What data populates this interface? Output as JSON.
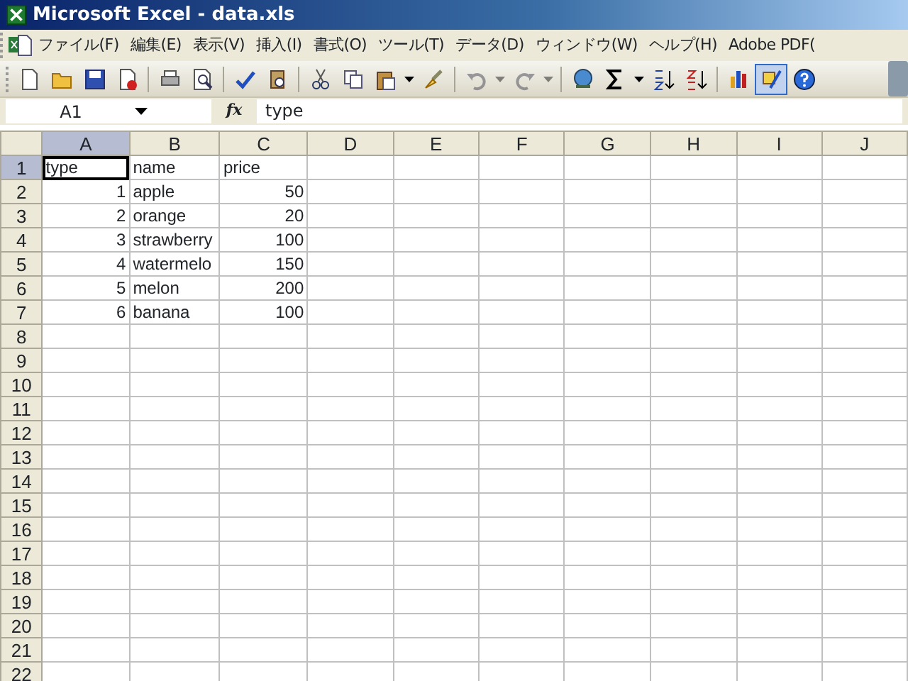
{
  "window": {
    "title": "Microsoft Excel - data.xls"
  },
  "menu": [
    {
      "label": "ファイル(F)"
    },
    {
      "label": "編集(E)"
    },
    {
      "label": "表示(V)"
    },
    {
      "label": "挿入(I)"
    },
    {
      "label": "書式(O)"
    },
    {
      "label": "ツール(T)"
    },
    {
      "label": "データ(D)"
    },
    {
      "label": "ウィンドウ(W)"
    },
    {
      "label": "ヘルプ(H)"
    },
    {
      "label": "Adobe PDF("
    }
  ],
  "toolbar": [
    {
      "kind": "new",
      "pressed": false,
      "disabled": false
    },
    {
      "kind": "open",
      "pressed": false,
      "disabled": false
    },
    {
      "kind": "save",
      "pressed": false,
      "disabled": false
    },
    {
      "kind": "permission",
      "pressed": false,
      "disabled": false
    },
    {
      "kind": "separator"
    },
    {
      "kind": "print",
      "pressed": false,
      "disabled": false
    },
    {
      "kind": "preview",
      "pressed": false,
      "disabled": false
    },
    {
      "kind": "separator"
    },
    {
      "kind": "spelling",
      "pressed": false,
      "disabled": false
    },
    {
      "kind": "research",
      "pressed": false,
      "disabled": false
    },
    {
      "kind": "separator"
    },
    {
      "kind": "cut",
      "pressed": false,
      "disabled": false
    },
    {
      "kind": "copy",
      "pressed": false,
      "disabled": false
    },
    {
      "kind": "paste",
      "pressed": false,
      "disabled": false
    },
    {
      "kind": "painter",
      "pressed": false,
      "disabled": false
    },
    {
      "kind": "separator"
    },
    {
      "kind": "undo",
      "pressed": false,
      "disabled": true
    },
    {
      "kind": "redo",
      "pressed": false,
      "disabled": true
    },
    {
      "kind": "separator"
    },
    {
      "kind": "link",
      "pressed": false,
      "disabled": false
    },
    {
      "kind": "sum",
      "pressed": false,
      "disabled": false
    },
    {
      "kind": "sortasc",
      "pressed": false,
      "disabled": false
    },
    {
      "kind": "sortdesc",
      "pressed": false,
      "disabled": false
    },
    {
      "kind": "separator"
    },
    {
      "kind": "chart",
      "pressed": false,
      "disabled": false
    },
    {
      "kind": "drawing",
      "pressed": true,
      "disabled": false
    },
    {
      "kind": "help",
      "pressed": false,
      "disabled": false
    }
  ],
  "formula_bar": {
    "name_box": "A1",
    "fx": "fx",
    "value": "type"
  },
  "sheet": {
    "columns": [
      {
        "label": "A",
        "selected": true
      },
      {
        "label": "B",
        "selected": false
      },
      {
        "label": "C",
        "selected": false
      },
      {
        "label": "D",
        "selected": false
      },
      {
        "label": "E",
        "selected": false
      },
      {
        "label": "F",
        "selected": false
      },
      {
        "label": "G",
        "selected": false
      },
      {
        "label": "H",
        "selected": false
      },
      {
        "label": "I",
        "selected": false
      },
      {
        "label": "J",
        "selected": false
      }
    ],
    "rows": [
      {
        "label": "1",
        "selected": true,
        "cells": [
          {
            "text": "type",
            "kind": "text"
          },
          {
            "text": "name",
            "kind": "text"
          },
          {
            "text": "price",
            "kind": "text"
          }
        ]
      },
      {
        "label": "2",
        "selected": false,
        "cells": [
          {
            "text": "1",
            "kind": "number"
          },
          {
            "text": "apple",
            "kind": "text"
          },
          {
            "text": "50",
            "kind": "number"
          }
        ]
      },
      {
        "label": "3",
        "selected": false,
        "cells": [
          {
            "text": "2",
            "kind": "number"
          },
          {
            "text": "orange",
            "kind": "text"
          },
          {
            "text": "20",
            "kind": "number"
          }
        ]
      },
      {
        "label": "4",
        "selected": false,
        "cells": [
          {
            "text": "3",
            "kind": "number"
          },
          {
            "text": "strawberry",
            "kind": "text"
          },
          {
            "text": "100",
            "kind": "number"
          }
        ]
      },
      {
        "label": "5",
        "selected": false,
        "cells": [
          {
            "text": "4",
            "kind": "number"
          },
          {
            "text": "watermelo",
            "kind": "text"
          },
          {
            "text": "150",
            "kind": "number"
          }
        ]
      },
      {
        "label": "6",
        "selected": false,
        "cells": [
          {
            "text": "5",
            "kind": "number"
          },
          {
            "text": "melon",
            "kind": "text"
          },
          {
            "text": "200",
            "kind": "number"
          }
        ]
      },
      {
        "label": "7",
        "selected": false,
        "cells": [
          {
            "text": "6",
            "kind": "number"
          },
          {
            "text": "banana",
            "kind": "text"
          },
          {
            "text": "100",
            "kind": "number"
          }
        ]
      },
      {
        "label": "8",
        "selected": false
      },
      {
        "label": "9",
        "selected": false
      },
      {
        "label": "10",
        "selected": false
      },
      {
        "label": "11",
        "selected": false
      },
      {
        "label": "12",
        "selected": false
      },
      {
        "label": "13",
        "selected": false
      },
      {
        "label": "14",
        "selected": false
      },
      {
        "label": "15",
        "selected": false
      },
      {
        "label": "16",
        "selected": false
      },
      {
        "label": "17",
        "selected": false
      },
      {
        "label": "18",
        "selected": false
      },
      {
        "label": "19",
        "selected": false
      },
      {
        "label": "20",
        "selected": false
      },
      {
        "label": "21",
        "selected": false
      },
      {
        "label": "22",
        "selected": false
      }
    ]
  }
}
